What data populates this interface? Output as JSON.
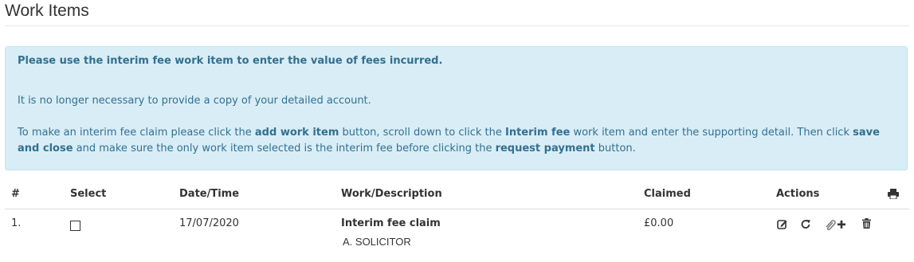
{
  "page": {
    "title": "Work Items"
  },
  "alert": {
    "lead": "Please use the interim fee work item to enter the value of fees incurred.",
    "line2": "It is no longer necessary to provide a copy of your detailed account.",
    "line3_part1": "To make an interim fee claim please click the ",
    "line3_bold1": "add work item",
    "line3_part2": " button, scroll down to click the ",
    "line3_bold2": "Interim fee",
    "line3_part3": " work item and enter the supporting detail. Then click ",
    "line3_bold3": "save and close",
    "line3_part4": " and make sure the only work item selected is the interim fee before clicking the ",
    "line3_bold4": "request payment",
    "line3_part5": " button."
  },
  "table": {
    "headers": {
      "num": "#",
      "select": "Select",
      "datetime": "Date/Time",
      "description": "Work/Description",
      "claimed": "Claimed",
      "actions": "Actions"
    },
    "rows": [
      {
        "num": "1.",
        "selected": false,
        "datetime": "17/07/2020",
        "description": "Interim fee claim",
        "author": "A. SOLICITOR",
        "claimed": "£0.00"
      }
    ]
  },
  "icons": {
    "print": "print-icon",
    "edit": "edit-icon",
    "redo": "redo-icon",
    "attach": "paperclip-plus-icon",
    "delete": "trash-icon"
  }
}
